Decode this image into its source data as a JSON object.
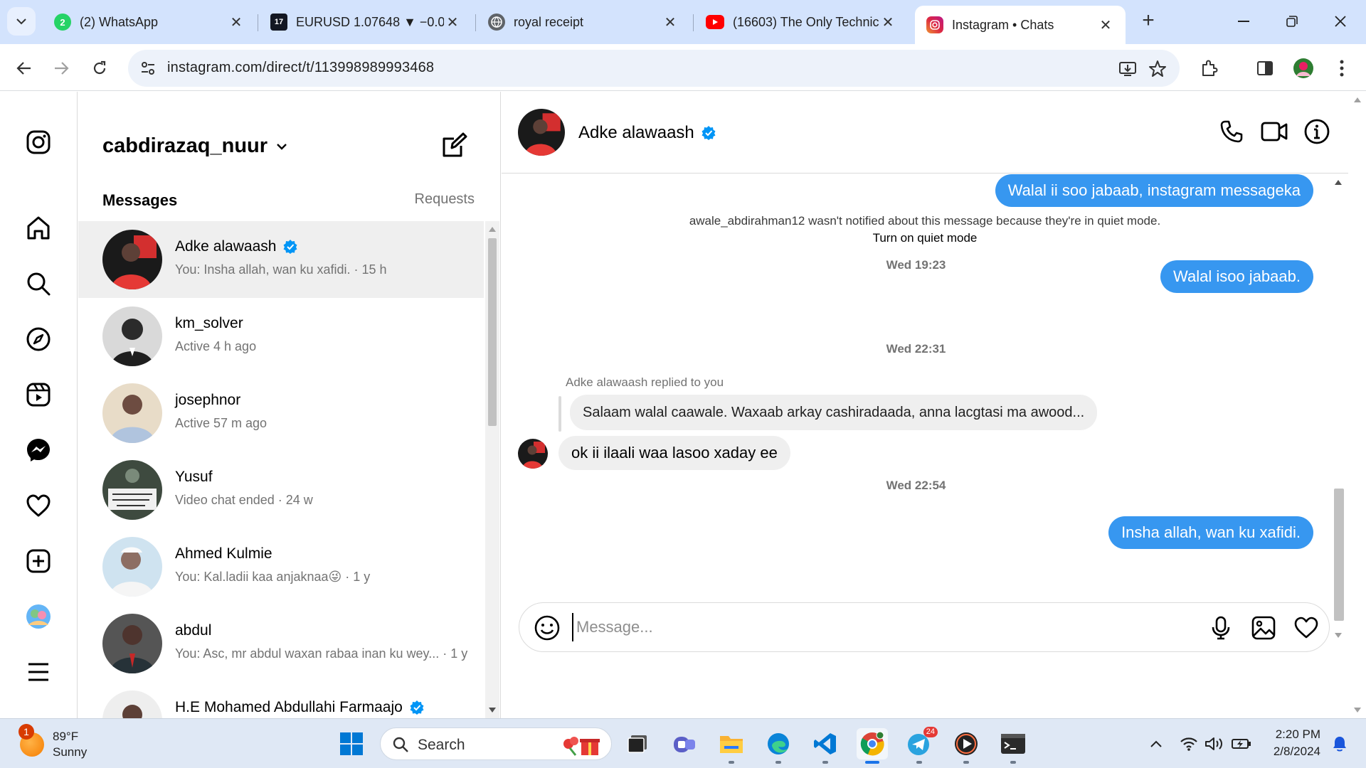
{
  "browser": {
    "tabs": [
      {
        "title": "(2) WhatsApp",
        "favicon": "whatsapp-icon",
        "badge": "2",
        "color": "#25d366"
      },
      {
        "title": "EURUSD 1.07648 ▼ −0.0",
        "favicon": "tradingview-icon",
        "badge": "17",
        "color": "#131722"
      },
      {
        "title": "royal receipt",
        "favicon": "globe-icon",
        "color": "#5f6368"
      },
      {
        "title": "(16603) The Only Technic",
        "favicon": "youtube-icon",
        "color": "#ff0000"
      },
      {
        "title": "Instagram • Chats",
        "favicon": "instagram-icon",
        "color": "#e1306c",
        "active": true
      }
    ],
    "url": "instagram.com/direct/t/113998989993468"
  },
  "inbox": {
    "username": "cabdirazaq_nuur",
    "messages_label": "Messages",
    "requests_label": "Requests",
    "conversations": [
      {
        "name": "Adke alawaash",
        "verified": true,
        "subtitle": "You: Insha allah, wan ku xafidi. · 15 h",
        "active": true
      },
      {
        "name": "km_solver",
        "verified": false,
        "subtitle": "Active 4 h ago"
      },
      {
        "name": "josephnor",
        "verified": false,
        "subtitle": "Active 57 m ago"
      },
      {
        "name": "Yusuf",
        "verified": false,
        "subtitle": "Video chat ended · 24 w"
      },
      {
        "name": "Ahmed Kulmie",
        "verified": false,
        "subtitle": "You: Kal.ladii kaa anjaknaa😜 · 1 y"
      },
      {
        "name": "abdul",
        "verified": false,
        "subtitle": "You: Asc, mr abdul waxan rabaa inan ku wey... · 1 y"
      },
      {
        "name": "H.E Mohamed Abdullahi Farmaajo",
        "verified": true,
        "subtitle": ""
      }
    ]
  },
  "chat": {
    "contact_name": "Adke alawaash",
    "verified": true,
    "messages": {
      "out_1": "Walal ii soo jabaab, instagram messageka",
      "notice_text": "awale_abdirahman12 wasn't notified about this message because they're in quiet mode.",
      "notice_link": "Turn on quiet mode",
      "time_1": "Wed 19:23",
      "out_2": "Walal isoo jabaab.",
      "time_2": "Wed 22:31",
      "reply_label": "Adke alawaash replied to you",
      "quoted": "Salaam walal caawale. Waxaab arkay cashiradaada, anna lacgtasi ma awood...",
      "in_1": "ok ii ilaali waa lasoo xaday ee",
      "time_3": "Wed 22:54",
      "out_3": "Insha allah, wan ku xafidi."
    },
    "composer_placeholder": "Message..."
  },
  "taskbar": {
    "weather_temp": "89°F",
    "weather_desc": "Sunny",
    "weather_badge": "1",
    "search_label": "Search",
    "telegram_badge": "24",
    "time": "2:20 PM",
    "date": "2/8/2024"
  },
  "colors": {
    "accent_blue": "#3797f0",
    "verified_blue": "#0095f6",
    "tabbar_bg": "#d3e3fd",
    "taskbar_bg": "#dfe8f5"
  }
}
